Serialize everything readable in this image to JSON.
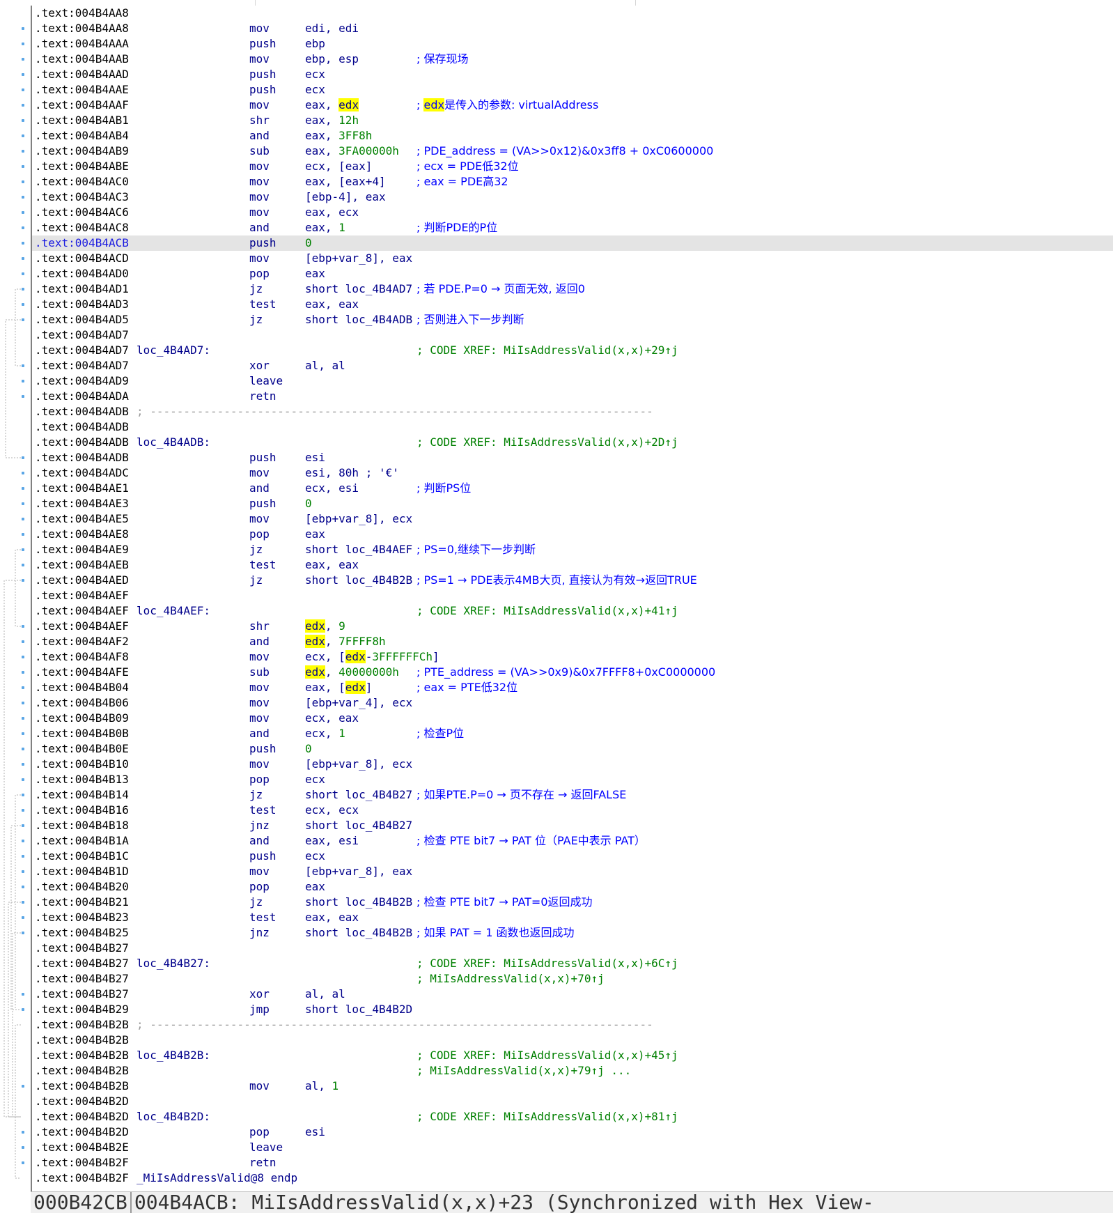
{
  "colors": {
    "current_line_bg": "#e4e4e4",
    "highlight": "#ffff00",
    "instruction": "#00008b",
    "comment": "#0000ff",
    "xref": "#008000"
  },
  "listing": [
    {
      "addr": ".text:004B4AA8"
    },
    {
      "addr": ".text:004B4AA8",
      "mn": "mov",
      "op": "edi, edi"
    },
    {
      "addr": ".text:004B4AAA",
      "mn": "push",
      "op": "ebp"
    },
    {
      "addr": ".text:004B4AAB",
      "mn": "mov",
      "op": "ebp, esp",
      "cmt": "; 保存现场"
    },
    {
      "addr": ".text:004B4AAD",
      "mn": "push",
      "op": "ecx"
    },
    {
      "addr": ".text:004B4AAE",
      "mn": "push",
      "op": "ecx"
    },
    {
      "addr": ".text:004B4AAF",
      "mn": "mov",
      "op": "eax, edx",
      "cmt": "; edx是传入的参数: virtualAddress"
    },
    {
      "addr": ".text:004B4AB1",
      "mn": "shr",
      "op": "eax, 12h"
    },
    {
      "addr": ".text:004B4AB4",
      "mn": "and",
      "op": "eax, 3FF8h"
    },
    {
      "addr": ".text:004B4AB9",
      "mn": "sub",
      "op": "eax, 3FA00000h",
      "cmt": "; PDE_address = (VA>>0x12)&0x3ff8 + 0xC0600000"
    },
    {
      "addr": ".text:004B4ABE",
      "mn": "mov",
      "op": "ecx, [eax]",
      "cmt": "; ecx = PDE低32位"
    },
    {
      "addr": ".text:004B4AC0",
      "mn": "mov",
      "op": "eax, [eax+4]",
      "cmt": "; eax = PDE高32"
    },
    {
      "addr": ".text:004B4AC3",
      "mn": "mov",
      "op": "[ebp-4], eax"
    },
    {
      "addr": ".text:004B4AC6",
      "mn": "mov",
      "op": "eax, ecx"
    },
    {
      "addr": ".text:004B4AC8",
      "mn": "and",
      "op": "eax, 1",
      "cmt": "; 判断PDE的P位"
    },
    {
      "addr": ".text:004B4ACB",
      "mn": "push",
      "op": "0",
      "current": true
    },
    {
      "addr": ".text:004B4ACD",
      "mn": "mov",
      "op": "[ebp+var_8], eax"
    },
    {
      "addr": ".text:004B4AD0",
      "mn": "pop",
      "op": "eax"
    },
    {
      "addr": ".text:004B4AD1",
      "mn": "jz",
      "op": "short loc_4B4AD7",
      "cmt": "; 若 PDE.P=0 → 页面无效, 返回0"
    },
    {
      "addr": ".text:004B4AD3",
      "mn": "test",
      "op": "eax, eax"
    },
    {
      "addr": ".text:004B4AD5",
      "mn": "jz",
      "op": "short loc_4B4ADB",
      "cmt": "; 否则进入下一步判断"
    },
    {
      "addr": ".text:004B4AD7"
    },
    {
      "addr": ".text:004B4AD7",
      "label": "loc_4B4AD7:",
      "xref": "; CODE XREF: MiIsAddressValid(x,x)+29↑j"
    },
    {
      "addr": ".text:004B4AD7",
      "mn": "xor",
      "op": "al, al"
    },
    {
      "addr": ".text:004B4AD9",
      "mn": "leave"
    },
    {
      "addr": ".text:004B4ADA",
      "mn": "retn"
    },
    {
      "addr": ".text:004B4ADB",
      "sep": "; ---------------------------------------------------------------------------"
    },
    {
      "addr": ".text:004B4ADB"
    },
    {
      "addr": ".text:004B4ADB",
      "label": "loc_4B4ADB:",
      "xref": "; CODE XREF: MiIsAddressValid(x,x)+2D↑j"
    },
    {
      "addr": ".text:004B4ADB",
      "mn": "push",
      "op": "esi"
    },
    {
      "addr": ".text:004B4ADC",
      "mn": "mov",
      "op": "esi, 80h ; '€'"
    },
    {
      "addr": ".text:004B4AE1",
      "mn": "and",
      "op": "ecx, esi",
      "cmt": "; 判断PS位"
    },
    {
      "addr": ".text:004B4AE3",
      "mn": "push",
      "op": "0"
    },
    {
      "addr": ".text:004B4AE5",
      "mn": "mov",
      "op": "[ebp+var_8], ecx"
    },
    {
      "addr": ".text:004B4AE8",
      "mn": "pop",
      "op": "eax"
    },
    {
      "addr": ".text:004B4AE9",
      "mn": "jz",
      "op": "short loc_4B4AEF",
      "cmt": "; PS=0,继续下一步判断"
    },
    {
      "addr": ".text:004B4AEB",
      "mn": "test",
      "op": "eax, eax"
    },
    {
      "addr": ".text:004B4AED",
      "mn": "jz",
      "op": "short loc_4B4B2B",
      "cmt": "; PS=1 → PDE表示4MB大页, 直接认为有效→返回TRUE"
    },
    {
      "addr": ".text:004B4AEF"
    },
    {
      "addr": ".text:004B4AEF",
      "label": "loc_4B4AEF:",
      "xref": "; CODE XREF: MiIsAddressValid(x,x)+41↑j"
    },
    {
      "addr": ".text:004B4AEF",
      "mn": "shr",
      "op": "edx, 9"
    },
    {
      "addr": ".text:004B4AF2",
      "mn": "and",
      "op": "edx, 7FFFF8h"
    },
    {
      "addr": ".text:004B4AF8",
      "mn": "mov",
      "op": "ecx, [edx-3FFFFFFCh]"
    },
    {
      "addr": ".text:004B4AFE",
      "mn": "sub",
      "op": "edx, 40000000h",
      "cmt": "; PTE_address = (VA>>0x9)&0x7FFFF8+0xC0000000"
    },
    {
      "addr": ".text:004B4B04",
      "mn": "mov",
      "op": "eax, [edx]",
      "cmt": "; eax = PTE低32位"
    },
    {
      "addr": ".text:004B4B06",
      "mn": "mov",
      "op": "[ebp+var_4], ecx"
    },
    {
      "addr": ".text:004B4B09",
      "mn": "mov",
      "op": "ecx, eax"
    },
    {
      "addr": ".text:004B4B0B",
      "mn": "and",
      "op": "ecx, 1",
      "cmt": "; 检查P位"
    },
    {
      "addr": ".text:004B4B0E",
      "mn": "push",
      "op": "0"
    },
    {
      "addr": ".text:004B4B10",
      "mn": "mov",
      "op": "[ebp+var_8], ecx"
    },
    {
      "addr": ".text:004B4B13",
      "mn": "pop",
      "op": "ecx"
    },
    {
      "addr": ".text:004B4B14",
      "mn": "jz",
      "op": "short loc_4B4B27",
      "cmt": "; 如果PTE.P=0 → 页不存在 → 返回FALSE"
    },
    {
      "addr": ".text:004B4B16",
      "mn": "test",
      "op": "ecx, ecx"
    },
    {
      "addr": ".text:004B4B18",
      "mn": "jnz",
      "op": "short loc_4B4B27"
    },
    {
      "addr": ".text:004B4B1A",
      "mn": "and",
      "op": "eax, esi",
      "cmt": "; 检查 PTE bit7 → PAT 位（PAE中表示 PAT）"
    },
    {
      "addr": ".text:004B4B1C",
      "mn": "push",
      "op": "ecx"
    },
    {
      "addr": ".text:004B4B1D",
      "mn": "mov",
      "op": "[ebp+var_8], eax"
    },
    {
      "addr": ".text:004B4B20",
      "mn": "pop",
      "op": "eax"
    },
    {
      "addr": ".text:004B4B21",
      "mn": "jz",
      "op": "short loc_4B4B2B",
      "cmt": "; 检查 PTE bit7 → PAT=0返回成功"
    },
    {
      "addr": ".text:004B4B23",
      "mn": "test",
      "op": "eax, eax"
    },
    {
      "addr": ".text:004B4B25",
      "mn": "jnz",
      "op": "short loc_4B4B2B",
      "cmt": "; 如果 PAT = 1 函数也返回成功"
    },
    {
      "addr": ".text:004B4B27"
    },
    {
      "addr": ".text:004B4B27",
      "label": "loc_4B4B27:",
      "xref": "; CODE XREF: MiIsAddressValid(x,x)+6C↑j"
    },
    {
      "addr": ".text:004B4B27",
      "xref": "; MiIsAddressValid(x,x)+70↑j"
    },
    {
      "addr": ".text:004B4B27",
      "mn": "xor",
      "op": "al, al"
    },
    {
      "addr": ".text:004B4B29",
      "mn": "jmp",
      "op": "short loc_4B4B2D"
    },
    {
      "addr": ".text:004B4B2B",
      "sep": "; ---------------------------------------------------------------------------"
    },
    {
      "addr": ".text:004B4B2B"
    },
    {
      "addr": ".text:004B4B2B",
      "label": "loc_4B4B2B:",
      "xref": "; CODE XREF: MiIsAddressValid(x,x)+45↑j"
    },
    {
      "addr": ".text:004B4B2B",
      "xref": "; MiIsAddressValid(x,x)+79↑j ..."
    },
    {
      "addr": ".text:004B4B2B",
      "mn": "mov",
      "op": "al, 1"
    },
    {
      "addr": ".text:004B4B2D"
    },
    {
      "addr": ".text:004B4B2D",
      "label": "loc_4B4B2D:",
      "xref": "; CODE XREF: MiIsAddressValid(x,x)+81↑j"
    },
    {
      "addr": ".text:004B4B2D",
      "mn": "pop",
      "op": "esi"
    },
    {
      "addr": ".text:004B4B2E",
      "mn": "leave"
    },
    {
      "addr": ".text:004B4B2F",
      "mn": "retn"
    },
    {
      "addr": ".text:004B4B2F",
      "label": "_MiIsAddressValid@8 endp"
    }
  ],
  "statusbar": {
    "file_offset": "000B42CB",
    "location": "004B4ACB: MiIsAddressValid(x,x)+23 (Synchronized with Hex View-"
  }
}
